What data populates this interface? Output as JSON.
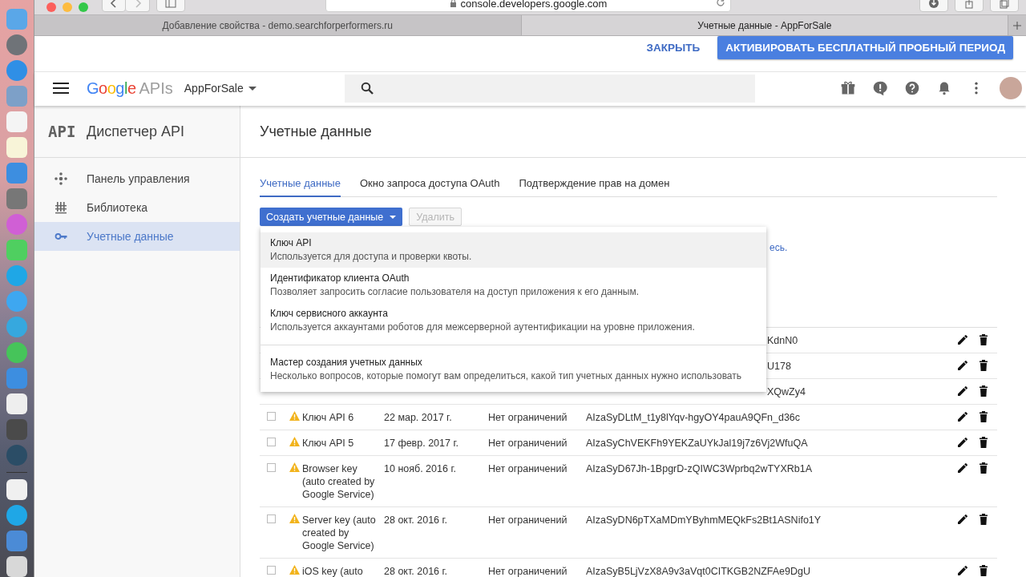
{
  "browser": {
    "url": "console.developers.google.com",
    "tabs": [
      {
        "title": "Добавление свойства - demo.searchforperformers.ru",
        "selected": false
      },
      {
        "title": "Учетные данные - AppForSale",
        "selected": true
      }
    ]
  },
  "banner": {
    "dismiss": "ЗАКРЫТЬ",
    "action": "АКТИВИРОВАТЬ БЕСПЛАТНЫЙ ПРОБНЫЙ ПЕРИОД"
  },
  "header": {
    "logo": {
      "brand": "Google",
      "product": "APIs"
    },
    "project": "AppForSale"
  },
  "sidebar": {
    "logo": "API",
    "title": "Диспетчер API",
    "items": [
      {
        "label": "Панель управления",
        "selected": false
      },
      {
        "label": "Библиотека",
        "selected": false
      },
      {
        "label": "Учетные данные",
        "selected": true
      }
    ]
  },
  "main": {
    "title": "Учетные данные",
    "tabs": [
      {
        "label": "Учетные данные",
        "selected": true
      },
      {
        "label": "Окно запроса доступа OAuth",
        "selected": false
      },
      {
        "label": "Подтверждение прав на домен",
        "selected": false
      }
    ],
    "create_button": "Создать учетные данные",
    "delete_button": {
      "label": "Удалить",
      "disabled": true
    },
    "notice_fragment": "есь.",
    "menu": {
      "items": [
        {
          "title": "Ключ API",
          "description": "Используется для доступа и проверки квоты.",
          "selected": true,
          "separated": false
        },
        {
          "title": "Идентификатор клиента OAuth",
          "description": "Позволяет запросить согласие пользователя на доступ приложения к его данным.",
          "selected": false,
          "separated": false
        },
        {
          "title": "Ключ сервисного аккаунта",
          "description": "Используется аккаунтами роботов для межсерверной аутентификации на уровне приложения.",
          "selected": false,
          "separated": false
        },
        {
          "title": "Мастер создания учетных данных",
          "description": "Несколько вопросов, которые помогут вам определиться, какой тип учетных данных нужно использовать",
          "selected": false,
          "separated": true
        }
      ]
    },
    "table": {
      "rows": [
        {
          "covered": true,
          "key": "KdnN0"
        },
        {
          "covered": true,
          "key": "U178"
        },
        {
          "covered": true,
          "key": "XQwZy4"
        },
        {
          "covered": false,
          "checked": false,
          "name": "Ключ API 6",
          "created": "22 мар. 2017 г.",
          "restriction": "Нет ограничений",
          "key": "AIzaSyDLtM_t1y8lYqv-hgyOY4pauA9QFn_d36c"
        },
        {
          "covered": false,
          "checked": false,
          "name": "Ключ API 5",
          "created": "17 февр. 2017 г.",
          "restriction": "Нет ограничений",
          "key": "AIzaSyChVEKFh9YEKZaUYkJal19j7z6Vj2WfuQA"
        },
        {
          "covered": false,
          "checked": false,
          "name": "Browser key (auto created by Google Service)",
          "created": "10 нояб. 2016 г.",
          "restriction": "Нет ограничений",
          "key": "AIzaSyD67Jh-1BpgrD-zQIWC3Wprbq2wTYXRb1A"
        },
        {
          "covered": false,
          "checked": false,
          "name": "Server key (auto created by Google Service)",
          "created": "28 окт. 2016 г.",
          "restriction": "Нет ограничений",
          "key": "AIzaSyDN6pTXaMDmYByhmMEQkFs2Bt1ASNifo1Y"
        },
        {
          "covered": false,
          "checked": false,
          "name": "iOS key (auto",
          "created": "28 окт. 2016 г.",
          "restriction": "Нет ограничений",
          "key": "AIzaSyB5LjVzX8A9v3aVqt0CITKGB2NZFAe9DgU"
        }
      ]
    }
  }
}
